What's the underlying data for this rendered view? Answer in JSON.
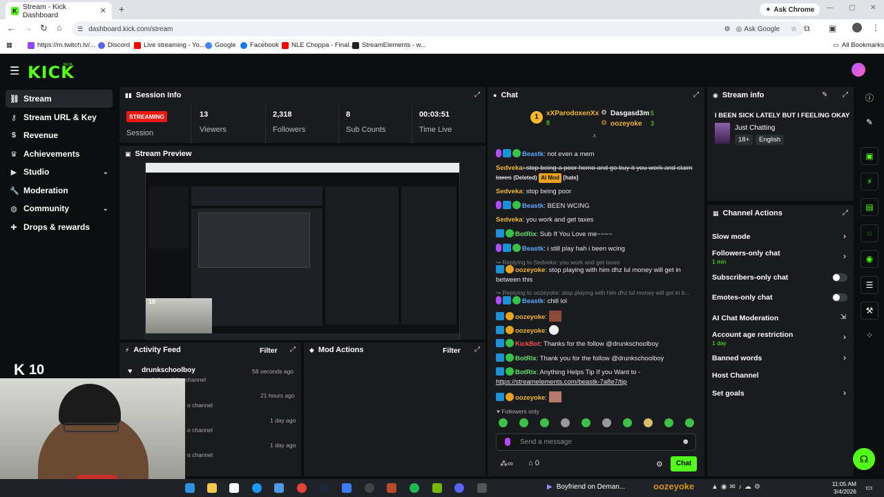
{
  "browser": {
    "tab_title": "Stream - Kick Dashboard",
    "new_tab": "+",
    "ask_chrome": "Ask Chrome",
    "url": "dashboard.kick.com/stream",
    "ask_google": "Ask Google",
    "bookmarks": [
      "https://m.twitch.tv/...",
      "Discord",
      "Live streaming - Yo...",
      "Google",
      "Facebook",
      "NLE Choppa - Final...",
      "StreamElements - w..."
    ],
    "all_bookmarks": "All Bookmarks"
  },
  "app": {
    "logo": "KICK",
    "logo_beta": "BETA"
  },
  "sidebar": {
    "items": [
      {
        "label": "Stream",
        "icon": "link-icon"
      },
      {
        "label": "Stream URL & Key",
        "icon": "key-icon"
      },
      {
        "label": "Revenue",
        "icon": "dollar-icon"
      },
      {
        "label": "Achievements",
        "icon": "trophy-icon"
      },
      {
        "label": "Studio",
        "icon": "studio-icon"
      },
      {
        "label": "Moderation",
        "icon": "wrench-icon"
      },
      {
        "label": "Community",
        "icon": "globe-icon"
      },
      {
        "label": "Drops & rewards",
        "icon": "gift-icon"
      }
    ]
  },
  "session": {
    "title": "Session Info",
    "status_badge": "STREAMING",
    "status_label": "Session",
    "stats": [
      {
        "value": "13",
        "label": "Viewers"
      },
      {
        "value": "2,318",
        "label": "Followers"
      },
      {
        "value": "8",
        "label": "Sub Counts"
      },
      {
        "value": "00:03:51",
        "label": "Time Live"
      }
    ]
  },
  "preview": {
    "title": "Stream Preview",
    "viewer_count": "10"
  },
  "activity": {
    "title": "Activity Feed",
    "filter": "Filter",
    "items": [
      {
        "user": "drunkschoolboy",
        "text": "just followed the channel",
        "time": "58 seconds ago"
      },
      {
        "user": "",
        "text": "o channel",
        "time": "21 hours ago"
      },
      {
        "user": "",
        "text": "o channel",
        "time": "1 day ago"
      },
      {
        "user": "",
        "text": "o channel",
        "time": "1 day ago"
      }
    ]
  },
  "mod_actions": {
    "title": "Mod Actions",
    "filter": "Filter"
  },
  "chat": {
    "title": "Chat",
    "gifters": [
      {
        "rank": "1",
        "name": "xXParodoxenXx",
        "count": "8"
      },
      {
        "name": "Dasgasd3m",
        "count": "5"
      },
      {
        "name": "oozeyoke",
        "count": "3"
      }
    ],
    "messages": [
      {
        "user": "Beastk",
        "text": ": not even a mem"
      },
      {
        "user": "Sedveka",
        "text": ": stop being a poor homo and go buy it you work and claim taxes",
        "deleted": "(Deleted)",
        "ai_mod": "AI Mod",
        "tag": "[hate]"
      },
      {
        "user": "Sedveka",
        "text": ": stop being poor"
      },
      {
        "user": "Beastk",
        "text": ": BEEN WCING"
      },
      {
        "user": "Sedveka",
        "text": ": you work and get taxes"
      },
      {
        "user": "BotRix",
        "text": ": Sub If You Love me~~~~"
      },
      {
        "user": "Beastk",
        "text": ": i still play hah i been wcing"
      },
      {
        "reply": "Replying to Sedveka: you work and get taxes",
        "user": "oozeyoke",
        "text": ": stop playing with him dhz lul money will get in between this"
      },
      {
        "reply": "Replying to oozeyoke: stop playing with him dhz lul money will get in b...",
        "user": "Beastk",
        "text": ": chill lol"
      },
      {
        "user": "oozeyoke",
        "text": ":"
      },
      {
        "user": "oozeyoke",
        "text": ":"
      },
      {
        "user": "KickBot",
        "text": ": Thanks for the follow @drunkschoolboy"
      },
      {
        "user": "BotRix",
        "text": ": Thank you for the follow @drunkschoolboy"
      },
      {
        "user": "BotRix",
        "text": ": Anything Helps Tip If you Want to -",
        "link": "https://streamelements.com/beastk-7a8e7/tip"
      },
      {
        "user": "oozeyoke",
        "text": ":"
      }
    ],
    "followers_only": "Followers only",
    "input_placeholder": "Send a message",
    "points": "∞",
    "gift_count": "0",
    "send": "Chat"
  },
  "stream_info": {
    "title": "Stream info",
    "stream_title": "I BEEN SICK LATELY BUT I FEELING OKAY",
    "category": "Just Chatting",
    "tags": [
      "18+",
      "English"
    ]
  },
  "channel_actions": {
    "title": "Channel Actions",
    "items": [
      {
        "label": "Slow mode",
        "sub": "",
        "control": "chevron"
      },
      {
        "label": "Followers-only chat",
        "sub": "1 min",
        "control": "chevron"
      },
      {
        "label": "Subscribers-only chat",
        "sub": "",
        "control": "toggle"
      },
      {
        "label": "Emotes-only chat",
        "sub": "",
        "control": "toggle"
      },
      {
        "label": "AI Chat Moderation",
        "sub": "",
        "control": "external"
      },
      {
        "label": "Account age restriction",
        "sub": "1 day",
        "control": "chevron"
      },
      {
        "label": "Banned words",
        "sub": "",
        "control": "chevron"
      },
      {
        "label": "Host Channel",
        "sub": "",
        "control": "none"
      },
      {
        "label": "Set goals",
        "sub": "",
        "control": "chevron"
      }
    ]
  },
  "overlay": {
    "kick_count": "10",
    "watermark": "oozeyoke"
  },
  "taskbar": {
    "media_title": "Boyfriend on Deman...",
    "time": "11:05 AM",
    "date": "3/4/2026"
  },
  "colors": {
    "accent": "#53fc18",
    "panel": "#191b1f",
    "background": "#0b0e0f",
    "streaming_badge": "#e91916"
  }
}
